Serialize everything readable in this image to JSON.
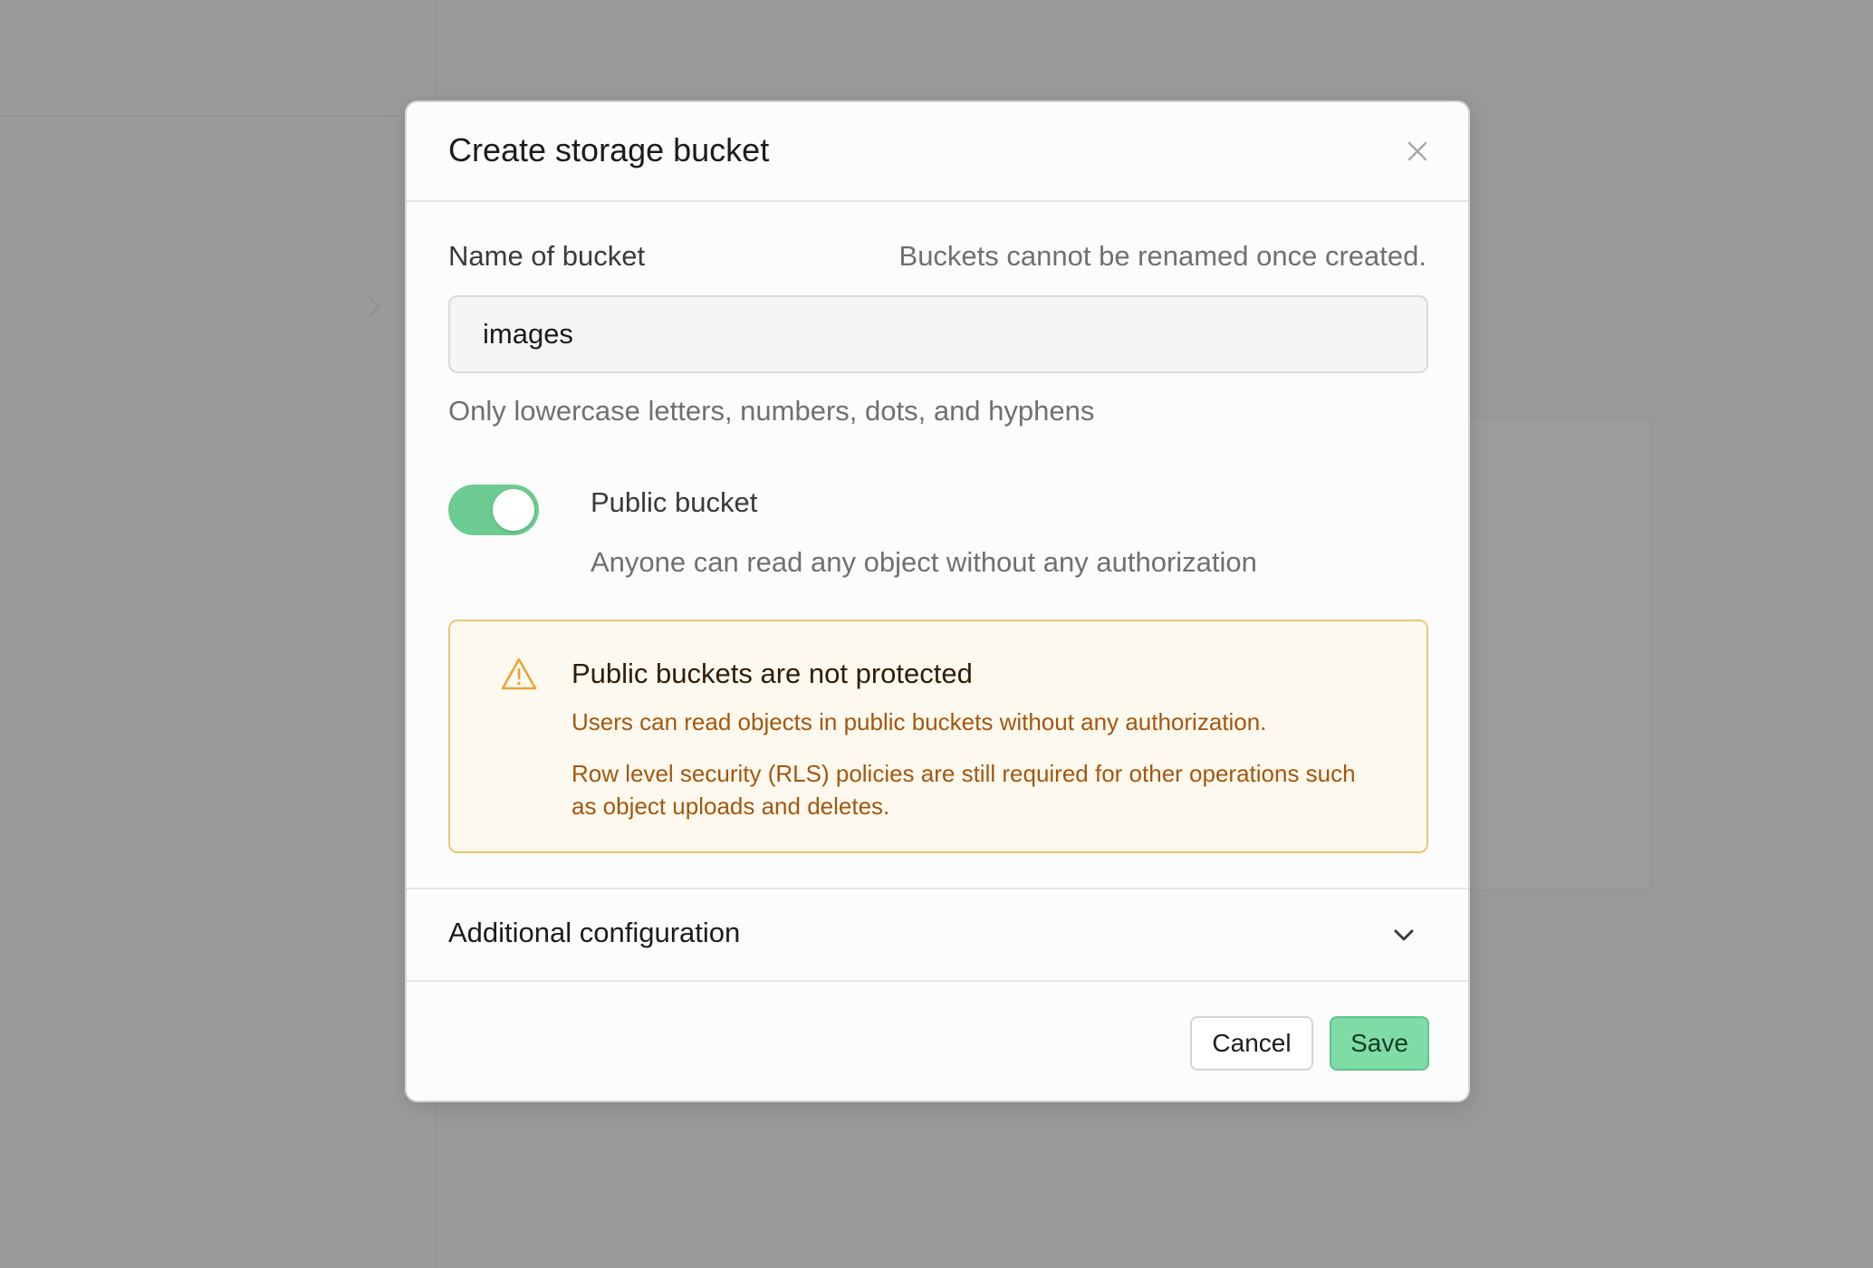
{
  "modal": {
    "title": "Create storage bucket",
    "close_icon": "close-icon"
  },
  "name_field": {
    "label": "Name of bucket",
    "hint": "Buckets cannot be renamed once created.",
    "value": "images",
    "description": "Only lowercase letters, numbers, dots, and hyphens"
  },
  "public_toggle": {
    "label": "Public bucket",
    "description": "Anyone can read any object without any authorization",
    "enabled": true,
    "color": "#6ccb90"
  },
  "warning": {
    "icon": "warning-triangle-icon",
    "title": "Public buckets are not protected",
    "text_1": "Users can read objects in public buckets without any authorization.",
    "text_2": "Row level security (RLS) policies are still required for other operations such as object uploads and deletes.",
    "color": "#a3570f"
  },
  "additional_config": {
    "label": "Additional configuration",
    "icon": "chevron-down-icon"
  },
  "footer": {
    "cancel_label": "Cancel",
    "save_label": "Save",
    "save_color": "#7fdca6"
  }
}
